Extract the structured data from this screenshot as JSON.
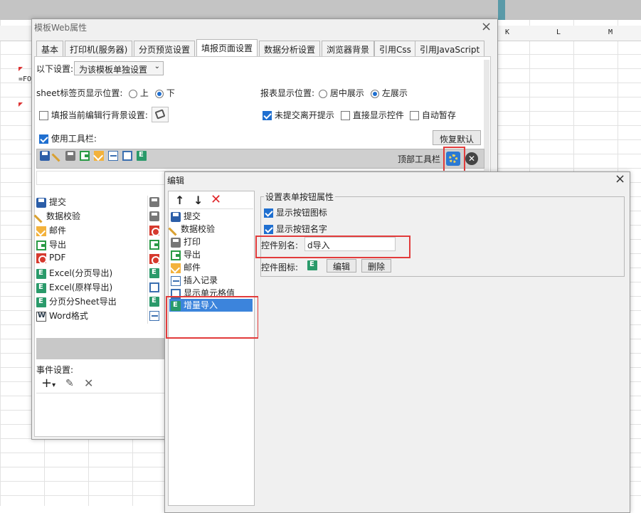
{
  "spreadsheet": {
    "columns": [
      "K",
      "L",
      "M"
    ],
    "cell_text": "=FO"
  },
  "main_dialog": {
    "title": "模板Web属性",
    "close": "×",
    "tabs": [
      "基本",
      "打印机(服务器)",
      "分页预览设置",
      "填报页面设置",
      "数据分析设置",
      "浏览器背景",
      "引用Css",
      "引用JavaScript"
    ],
    "active_tab": "填报页面设置",
    "settings_label": "以下设置:",
    "settings_value": "为该模板单独设置",
    "sheet_tab_label": "sheet标签页显示位置:",
    "sheet_tab_options": [
      "上",
      "下"
    ],
    "sheet_tab_selected": "下",
    "report_pos_label": "报表显示位置:",
    "report_pos_options": [
      "居中展示",
      "左展示"
    ],
    "report_pos_selected": "左展示",
    "fill_bg_label": "填报当前编辑行背景设置:",
    "unsubmitted_label": "未提交离开提示",
    "show_control_label": "直接显示控件",
    "autosave_label": "自动暂存",
    "use_toolbar_label": "使用工具栏:",
    "restore_default": "恢复默认",
    "top_toolbar_label": "顶部工具栏",
    "left_list": [
      {
        "label": "提交",
        "icon": "save"
      },
      {
        "label": "数据校验",
        "icon": "check"
      },
      {
        "label": "邮件",
        "icon": "mail"
      },
      {
        "label": "导出",
        "icon": "export"
      },
      {
        "label": "PDF",
        "icon": "pdf"
      },
      {
        "label": "Excel(分页导出)",
        "icon": "excel"
      },
      {
        "label": "Excel(原样导出)",
        "icon": "excel"
      },
      {
        "label": "分页分Sheet导出",
        "icon": "excel"
      },
      {
        "label": "Word格式",
        "icon": "word"
      }
    ],
    "event_label": "事件设置:"
  },
  "edit_dialog": {
    "title": "编辑",
    "close": "×",
    "items": [
      {
        "label": "提交",
        "icon": "save"
      },
      {
        "label": "数据校验",
        "icon": "check"
      },
      {
        "label": "打印",
        "icon": "print"
      },
      {
        "label": "导出",
        "icon": "export"
      },
      {
        "label": "邮件",
        "icon": "mail"
      },
      {
        "label": "插入记录",
        "icon": "insert"
      },
      {
        "label": "显示单元格值",
        "icon": "cell"
      },
      {
        "label": "增量导入",
        "icon": "excel"
      }
    ],
    "selected_item": "增量导入",
    "group_title": "设置表单按钮属性",
    "show_icon_label": "显示按钮图标",
    "show_name_label": "显示按钮名字",
    "alias_label": "控件别名:",
    "alias_value": "d导入",
    "icon_label": "控件图标:",
    "edit_button": "编辑",
    "delete_button": "删除"
  },
  "colors": {
    "accent": "#1f6fd0",
    "highlight": "#e23b3b",
    "selection": "#3c84dc"
  }
}
